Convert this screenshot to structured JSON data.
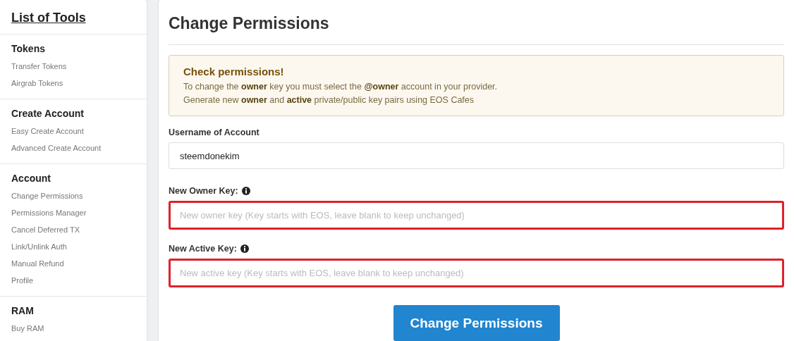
{
  "sidebar": {
    "title": "List of Tools",
    "sections": [
      {
        "heading": "Tokens",
        "items": [
          "Transfer Tokens",
          "Airgrab Tokens"
        ]
      },
      {
        "heading": "Create Account",
        "items": [
          "Easy Create Account",
          "Advanced Create Account"
        ]
      },
      {
        "heading": "Account",
        "items": [
          "Change Permissions",
          "Permissions Manager",
          "Cancel Deferred TX",
          "Link/Unlink Auth",
          "Manual Refund",
          "Profile"
        ]
      },
      {
        "heading": "RAM",
        "items": [
          "Buy RAM"
        ]
      }
    ]
  },
  "main": {
    "title": "Change Permissions",
    "alert": {
      "title": "Check permissions!",
      "lines": [
        "To change the **owner** key you must select the **@owner** account in your provider.",
        "Generate new **owner** and **active** private/public key pairs using EOS Cafes"
      ]
    },
    "fields": [
      {
        "label": "Username of Account",
        "info": false,
        "value": "steemdonekim",
        "highlighted": false
      },
      {
        "label": "New Owner Key:",
        "info": true,
        "placeholder": "New owner key (Key starts with EOS, leave blank to keep unchanged)",
        "highlighted": true
      },
      {
        "label": "New Active Key:",
        "info": true,
        "placeholder": "New active key (Key starts with EOS, leave blank to keep unchanged)",
        "highlighted": true
      }
    ],
    "submit": "Change Permissions"
  }
}
